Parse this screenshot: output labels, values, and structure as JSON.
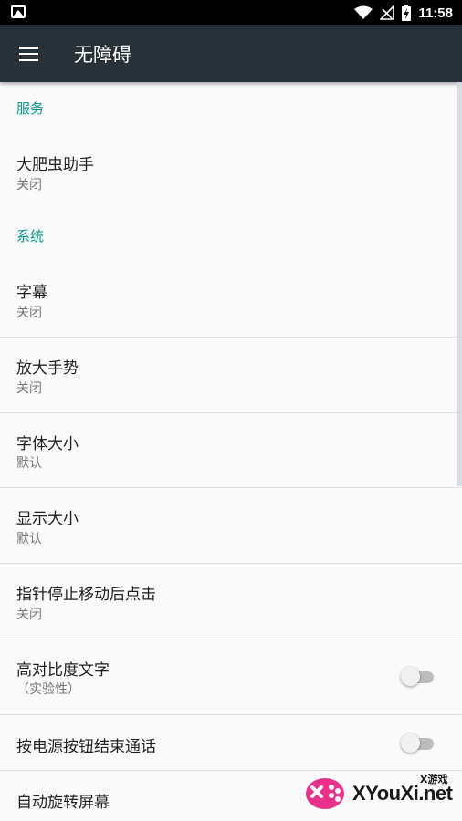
{
  "status_bar": {
    "time": "11:58",
    "icons": [
      "image-icon",
      "wifi-icon",
      "no-signal-icon",
      "battery-charging-icon"
    ]
  },
  "app_bar": {
    "title": "无障碍",
    "nav_icon": "menu-icon"
  },
  "sections": [
    {
      "header": "服务",
      "items": [
        {
          "title": "大肥虫助手",
          "summary": "关闭"
        }
      ]
    },
    {
      "header": "系统",
      "items": [
        {
          "title": "字幕",
          "summary": "关闭"
        },
        {
          "title": "放大手势",
          "summary": "关闭"
        },
        {
          "title": "字体大小",
          "summary": "默认"
        },
        {
          "title": "显示大小",
          "summary": "默认"
        },
        {
          "title": "指针停止移动后点击",
          "summary": "关闭"
        },
        {
          "title": "高对比度文字",
          "summary": "（实验性）",
          "switch": false
        },
        {
          "title": "按电源按钮结束通话",
          "switch": false
        },
        {
          "title": "自动旋转屏幕"
        }
      ]
    }
  ],
  "watermark": {
    "brand": "XYouXi.net",
    "tag": "X游戏"
  },
  "colors": {
    "accent": "#009688",
    "app_bar": "#263238",
    "background": "#fafafa",
    "status_bar": "#000000"
  }
}
